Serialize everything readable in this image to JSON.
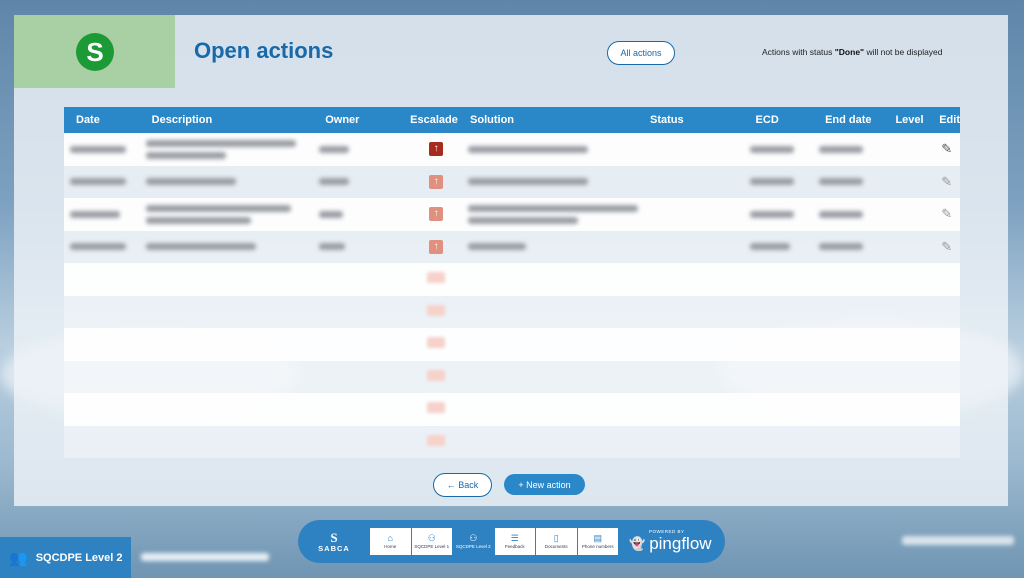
{
  "page": {
    "title": "Open actions",
    "logo_letter": "S"
  },
  "header": {
    "all_actions_label": "All actions",
    "notice_prefix": "Actions with status ",
    "notice_status": "\"Done\"",
    "notice_suffix": " will not be displayed"
  },
  "table": {
    "columns": [
      "Date",
      "Description",
      "Owner",
      "Escalade",
      "Solution",
      "Status",
      "ECD",
      "End date",
      "Level",
      "Edit"
    ],
    "empty_rows": 6
  },
  "actions": {
    "back_label": "Back",
    "new_label": "New action"
  },
  "footer": {
    "level_label": "SQCDPE Level 2"
  },
  "nav": {
    "brand": "SABCA",
    "items": [
      {
        "label": "Home",
        "icon": "home-icon"
      },
      {
        "label": "SQCDPE Level 1",
        "icon": "people-icon"
      },
      {
        "label": "SQCDPE Level 2",
        "icon": "people-icon",
        "active": true
      },
      {
        "label": "Feedback",
        "icon": "list-icon"
      },
      {
        "label": "Documents",
        "icon": "document-icon"
      },
      {
        "label": "Phone numbers",
        "icon": "phonebook-icon"
      }
    ],
    "powered_by": "POWERED BY",
    "pingflow": "pingflow"
  },
  "colors": {
    "accent": "#2b88c8",
    "title": "#1769aa",
    "logo_bg": "#a9d0a5",
    "logo_circle": "#1c9a35",
    "escalade": "#a62a1d"
  }
}
